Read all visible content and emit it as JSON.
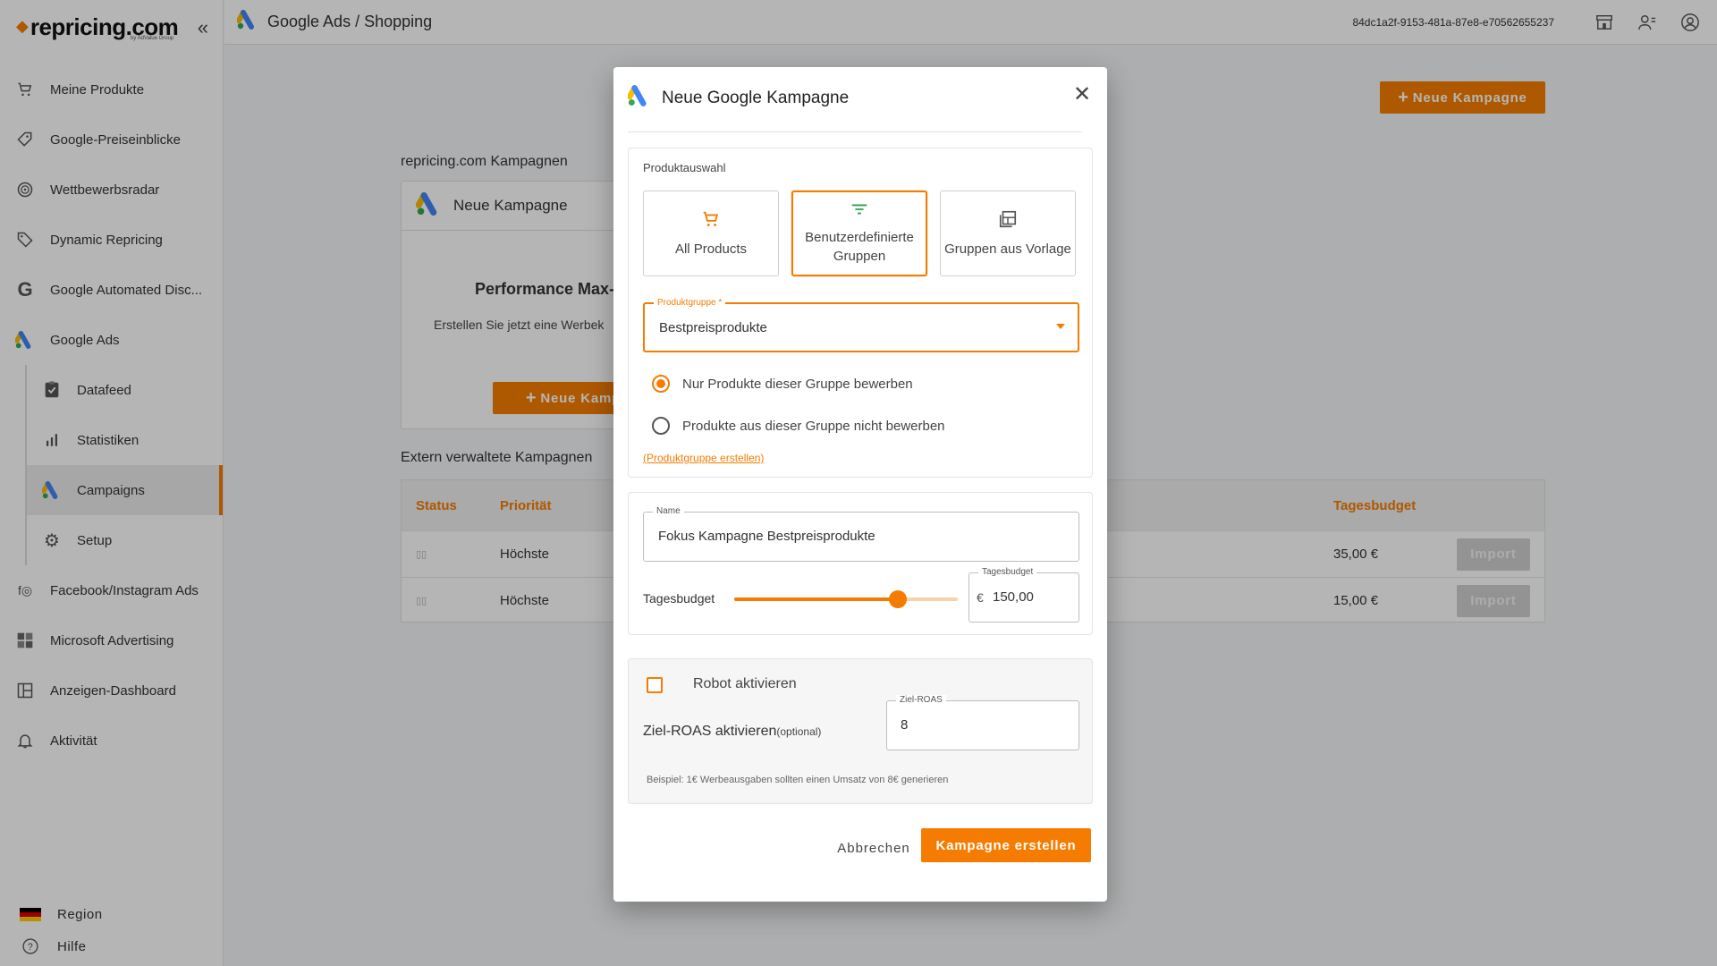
{
  "app": {
    "logo_text": "repricing.com",
    "logo_sub": "by AdValue Group",
    "breadcrumb": "Google Ads / Shopping",
    "user_id": "84dc1a2f-9153-481a-87e8-e70562655237"
  },
  "sidebar": {
    "items": [
      {
        "label": "Meine Produkte",
        "icon": "cart-icon"
      },
      {
        "label": "Google-Preiseinblicke",
        "icon": "price-tag-icon"
      },
      {
        "label": "Wettbewerbsradar",
        "icon": "radar-icon"
      },
      {
        "label": "Dynamic Repricing",
        "icon": "tag-icon"
      },
      {
        "label": "Google Automated Disc...",
        "icon": "google-g-icon"
      },
      {
        "label": "Google Ads",
        "icon": "google-ads-icon"
      }
    ],
    "sub_items": [
      {
        "label": "Datafeed",
        "icon": "clipboard-icon"
      },
      {
        "label": "Statistiken",
        "icon": "bar-chart-icon"
      },
      {
        "label": "Campaigns",
        "icon": "google-ads-icon",
        "active": true
      },
      {
        "label": "Setup",
        "icon": "gear-icon"
      }
    ],
    "items_after": [
      {
        "label": "Facebook/Instagram Ads",
        "icon": "facebook-instagram-icon"
      },
      {
        "label": "Microsoft Advertising",
        "icon": "microsoft-icon"
      },
      {
        "label": "Anzeigen-Dashboard",
        "icon": "dashboard-icon"
      },
      {
        "label": "Aktivität",
        "icon": "bell-icon"
      }
    ],
    "region_label": "Region",
    "help_label": "Hilfe"
  },
  "page": {
    "new_campaign_button": "Neue Kampagne",
    "own_campaigns_title": "repricing.com Kampagnen",
    "card_head": "Neue Kampagne",
    "card_title": "Performance Max-",
    "card_subtitle": "Erstellen Sie jetzt eine Werbek",
    "card_button": "Neue Kamp",
    "external_title": "Extern verwaltete Kampagnen",
    "table": {
      "headers": [
        "Status",
        "Priorität",
        "Tagesbudget"
      ],
      "rows": [
        {
          "status": "▯▯",
          "priority": "Höchste",
          "budget": "35,00 €",
          "action": "Import"
        },
        {
          "status": "▯▯",
          "priority": "Höchste",
          "budget": "15,00 €",
          "action": "Import"
        }
      ]
    }
  },
  "modal": {
    "title": "Neue Google Kampagne",
    "product_section_label": "Produktauswahl",
    "choices": [
      {
        "label": "All Products",
        "icon": "cart-icon",
        "selected": false
      },
      {
        "label": "Benutzerdefinierte Gruppen",
        "icon": "filter-icon",
        "selected": true
      },
      {
        "label": "Gruppen aus Vorlage",
        "icon": "template-icon",
        "selected": false
      }
    ],
    "product_group": {
      "label": "Produktgruppe *",
      "value": "Bestpreisprodukte"
    },
    "radio_include": "Nur Produkte dieser Gruppe bewerben",
    "radio_exclude": "Produkte aus dieser Gruppe nicht bewerben",
    "create_group_link": "(Produktgruppe erstellen)",
    "name_field": {
      "label": "Name",
      "value": "Fokus Kampagne Bestpreisprodukte"
    },
    "budget": {
      "slider_label": "Tagesbudget",
      "field_label": "Tagesbudget",
      "currency": "€",
      "value": "150,00",
      "slider_fraction": 0.73
    },
    "robot_label": "Robot aktivieren",
    "roas_label": "Ziel-ROAS aktivieren",
    "roas_optional": "(optional)",
    "roas_field": {
      "label": "Ziel-ROAS",
      "value": "8"
    },
    "hint": "Beispiel: 1€ Werbeausgaben sollten einen Umsatz von 8€ generieren",
    "cancel_label": "Abbrechen",
    "create_label": "Kampagne erstellen"
  },
  "colors": {
    "accent": "#f57c00",
    "google_blue": "#4285f4",
    "google_yellow": "#fbbc04",
    "google_green": "#34a853"
  }
}
